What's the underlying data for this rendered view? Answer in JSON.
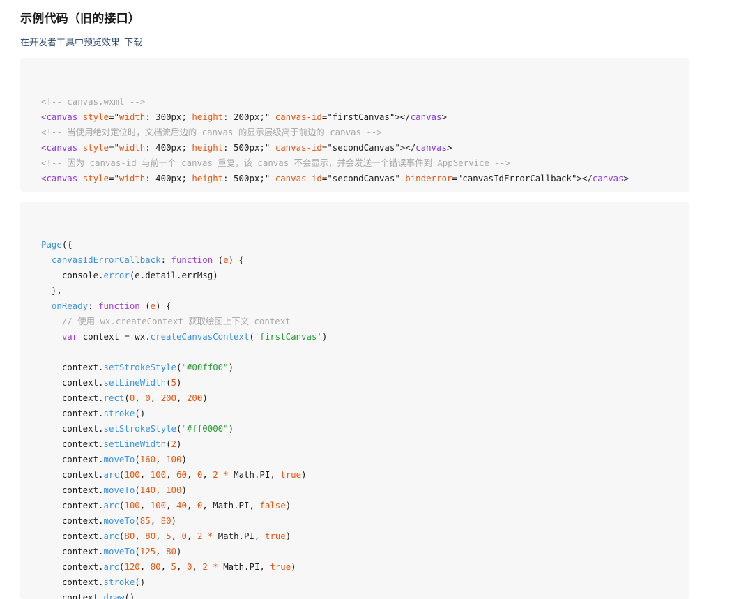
{
  "header": {
    "title": "示例代码（旧的接口）",
    "preview_text": "在开发者工具中预览效果",
    "download_label": "下载"
  },
  "wxml_block": {
    "lines": [
      "<!-- canvas.wxml -->",
      "<canvas style=\"width: 300px; height: 200px;\" canvas-id=\"firstCanvas\"></canvas>",
      "<!-- 当使用绝对定位时，文档流后边的 canvas 的显示层级高于前边的 canvas -->",
      "<canvas style=\"width: 400px; height: 500px;\" canvas-id=\"secondCanvas\"></canvas>",
      "<!-- 因为 canvas-id 与前一个 canvas 重复，该 canvas 不会显示，并会发送一个错误事件到 AppService -->",
      "<canvas style=\"width: 400px; height: 500px;\" canvas-id=\"secondCanvas\" binderror=\"canvasIdErrorCallback\"></canvas>"
    ]
  },
  "js_block": {
    "lines": [
      "Page({",
      "  canvasIdErrorCallback: function (e) {",
      "    console.error(e.detail.errMsg)",
      "  },",
      "  onReady: function (e) {",
      "    // 使用 wx.createContext 获取绘图上下文 context",
      "    var context = wx.createCanvasContext('firstCanvas')",
      "",
      "    context.setStrokeStyle(\"#00ff00\")",
      "    context.setLineWidth(5)",
      "    context.rect(0, 0, 200, 200)",
      "    context.stroke()",
      "    context.setStrokeStyle(\"#ff0000\")",
      "    context.setLineWidth(2)",
      "    context.moveTo(160, 100)",
      "    context.arc(100, 100, 60, 0, 2 * Math.PI, true)",
      "    context.moveTo(140, 100)",
      "    context.arc(100, 100, 40, 0, Math.PI, false)",
      "    context.moveTo(85, 80)",
      "    context.arc(80, 80, 5, 0, 2 * Math.PI, true)",
      "    context.moveTo(125, 80)",
      "    context.arc(120, 80, 5, 0, 2 * Math.PI, true)",
      "    context.stroke()",
      "    context.draw()"
    ]
  }
}
